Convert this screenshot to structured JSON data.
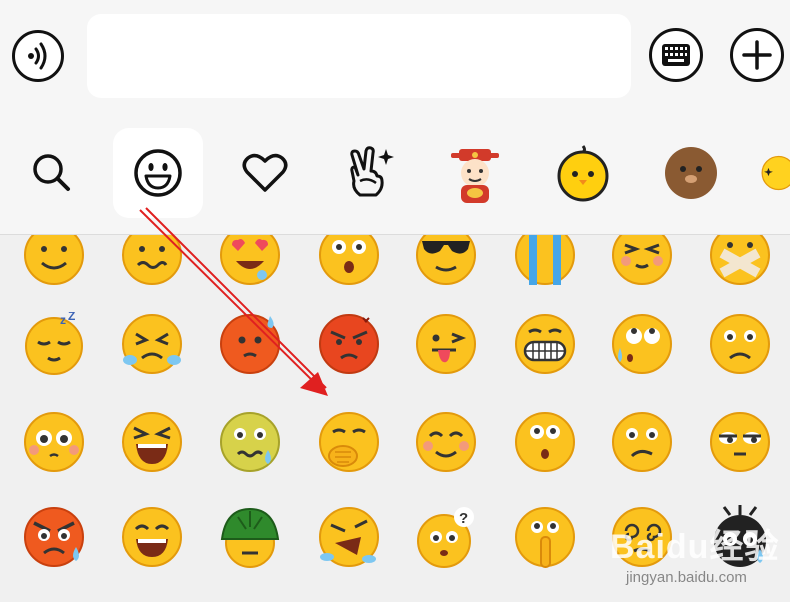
{
  "input": {
    "value": "",
    "placeholder": ""
  },
  "categories": [
    {
      "name": "search",
      "icon": "search-icon"
    },
    {
      "name": "emoji",
      "icon": "smiley-icon",
      "selected": true
    },
    {
      "name": "favorites",
      "icon": "heart-icon"
    },
    {
      "name": "gestures",
      "icon": "victory-hand-icon"
    },
    {
      "name": "sticker-pack-god-of-wealth",
      "icon": "god-of-wealth-icon"
    },
    {
      "name": "sticker-pack-yellow-chick",
      "icon": "yellow-chick-icon"
    },
    {
      "name": "sticker-pack-brown-face",
      "icon": "brown-face-icon"
    },
    {
      "name": "sticker-pack-more",
      "icon": "partial-sticker-icon"
    }
  ],
  "emoji_rows": [
    [
      "smiling-face",
      "wavy-mouth-face",
      "heart-eyes-face",
      "shocked-face",
      "sunglasses-face",
      "crying-rivers-face",
      "shy-squint-face",
      "taped-mouth-face"
    ],
    [
      "sleepy-zzz-face",
      "crying-squint-face",
      "angry-sweat-face",
      "furious-red-face",
      "tongue-wink-face",
      "grinning-teeth-face",
      "eye-roll-sweat-face",
      "sad-frown-face"
    ],
    [
      "teary-eyes-face",
      "laughing-crying-face",
      "sick-green-face",
      "covering-mouth-face",
      "happy-blush-face",
      "shocked-o-face",
      "confused-frown-face",
      "side-eye-face"
    ],
    [
      "angry-red-face",
      "big-grin-face",
      "turtle-shell-face",
      "shouting-tears-face",
      "question-sweat-face",
      "hushing-face",
      "dizzy-swirl-face",
      "black-smudge-face"
    ]
  ],
  "watermark": {
    "logo": "Baidu经验",
    "url": "jingyan.baidu.com"
  },
  "colors": {
    "accent_arrow": "#e02020",
    "emoji_yellow": "#fbc21f"
  }
}
